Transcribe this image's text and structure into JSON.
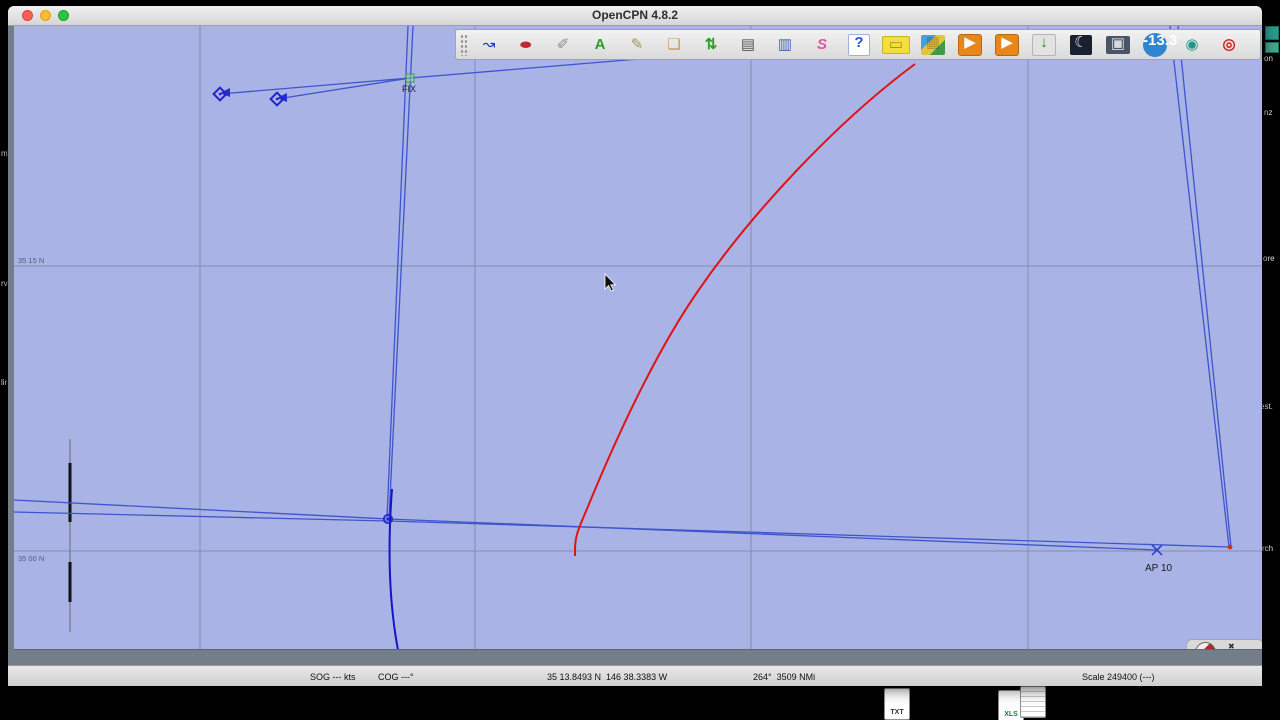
{
  "window": {
    "title": "OpenCPN 4.8.2"
  },
  "toolbar": {
    "items": [
      {
        "name": "create-route-icon",
        "glyph": "↝"
      },
      {
        "name": "auto-follow-icon",
        "glyph": "●"
      },
      {
        "name": "settings-icon",
        "glyph": "✐"
      },
      {
        "name": "enc-text-icon",
        "glyph": "A"
      },
      {
        "name": "ais-targets-icon",
        "glyph": "✎"
      },
      {
        "name": "currents-icon",
        "glyph": "❏"
      },
      {
        "name": "tides-icon",
        "glyph": "⇅"
      },
      {
        "name": "print-icon",
        "glyph": "▤"
      },
      {
        "name": "route-manager-icon",
        "glyph": "▥"
      },
      {
        "name": "tracks-icon",
        "glyph": "S"
      },
      {
        "name": "help-icon",
        "glyph": "?"
      },
      {
        "name": "measure-icon",
        "glyph": "▭"
      },
      {
        "name": "chart-downloader-icon",
        "glyph": "▦"
      },
      {
        "name": "grib-icon",
        "glyph": "▶"
      },
      {
        "name": "logbook-icon",
        "glyph": "▶"
      },
      {
        "name": "download-icon",
        "glyph": "↓"
      },
      {
        "name": "celestial-nav-icon",
        "glyph": "☾"
      },
      {
        "name": "snapshot-icon",
        "glyph": "▣"
      },
      {
        "name": "wmm-variation-icon",
        "glyph": "-13.3"
      },
      {
        "name": "globe-plugin-icon",
        "glyph": "◉"
      },
      {
        "name": "mob-icon",
        "glyph": "◎"
      }
    ]
  },
  "chart": {
    "water_color": "#a9b3e6",
    "route_color": "#3f55cc",
    "track_color": "#1515c8",
    "red_route_color": "#e01414",
    "graticule": {
      "lat_labels": [
        "35 15 N",
        "35 00 N"
      ]
    },
    "waypoints": {
      "fix_label": "FIX",
      "ap_label": "AP 10"
    }
  },
  "statusbar": {
    "sog": "SOG --- kts",
    "cog": "COG ---°",
    "cursor_position": "35 13.8493 N  146 38.3383 W",
    "cursor_bearing_distance": "264°  3509 NMi",
    "scale": "Scale 249400 (---)"
  },
  "desktop": {
    "left_fragments": [
      "mW",
      "rvi",
      "lir"
    ],
    "right_fragments": [
      "on",
      "nz",
      "ore",
      "est.",
      "rch"
    ],
    "files": [
      {
        "label": "TXT"
      },
      {
        "label": "XLS"
      }
    ]
  }
}
